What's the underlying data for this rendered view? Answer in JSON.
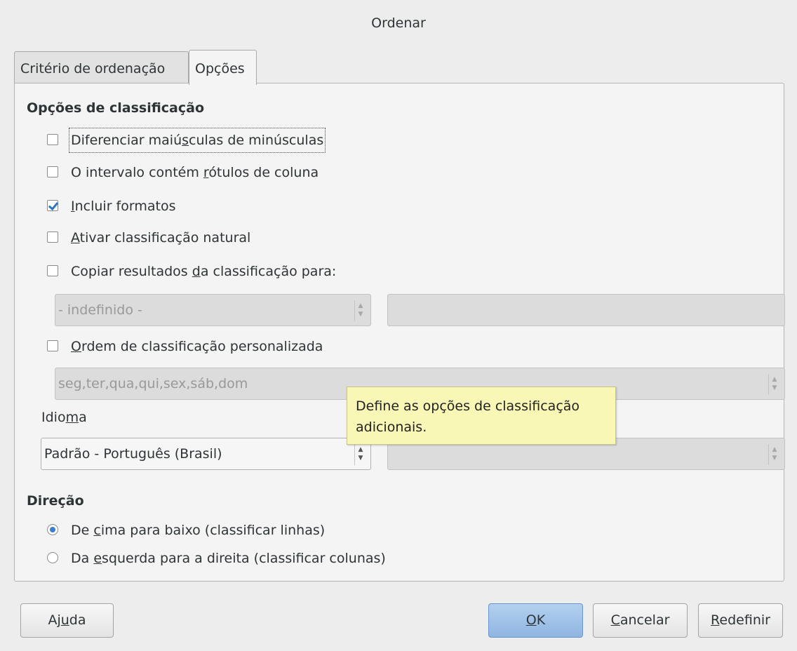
{
  "window": {
    "title": "Ordenar"
  },
  "tabs": [
    {
      "label": "Critério de ordenação",
      "active": false
    },
    {
      "label": "Opções",
      "active": true
    }
  ],
  "sort_options": {
    "title": "Opções de classificação",
    "case_sensitive": {
      "pre": "Diferenciar maiú",
      "u": "s",
      "post": "culas de minúsculas",
      "checked": false
    },
    "has_headers": {
      "pre": "O intervalo contém ",
      "u": "r",
      "post": "ótulos de coluna",
      "checked": false
    },
    "include_formats": {
      "pre": "",
      "u": "I",
      "post": "ncluir formatos",
      "checked": true
    },
    "natural_sort": {
      "pre": "",
      "u": "A",
      "post": "tivar classificação natural",
      "checked": false
    },
    "copy_results": {
      "pre": "Copiar resultados ",
      "u": "d",
      "post": "a classificação para:",
      "checked": false
    },
    "copy_target_select": "- indefinido -",
    "copy_target_input": "",
    "custom_order": {
      "pre": "",
      "u": "O",
      "post": "rdem de classificação personalizada",
      "checked": false
    },
    "custom_order_select": "seg,ter,qua,qui,sex,sáb,dom",
    "language_label_pre": "Idio",
    "language_label_u": "m",
    "language_label_post": "a",
    "language_select": "Padrão - Português (Brasil)",
    "algorithm_select": ""
  },
  "tooltip": "Define as opções de classificação adicionais.",
  "direction": {
    "title": "Direção",
    "top_bottom": {
      "pre": "De ",
      "u": "c",
      "post": "ima para baixo (classificar linhas)",
      "selected": true
    },
    "left_right": {
      "pre": "Da ",
      "u": "e",
      "post": "squerda para a direita (classificar colunas)",
      "selected": false
    }
  },
  "buttons": {
    "help": {
      "pre": "Aj",
      "u": "u",
      "post": "da"
    },
    "ok": {
      "pre": "",
      "u": "O",
      "post": "K"
    },
    "cancel": {
      "pre": "",
      "u": "C",
      "post": "ancelar"
    },
    "reset": {
      "pre": "",
      "u": "R",
      "post": "edefinir"
    }
  },
  "colors": {
    "accent": "#3c7fcf",
    "tooltip_bg": "#f9f7b6",
    "ok_button": "#a3c4e8"
  }
}
